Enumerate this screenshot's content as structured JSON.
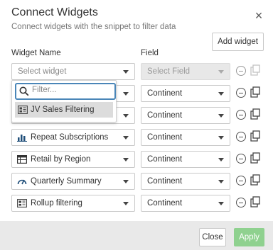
{
  "dialog": {
    "title": "Connect Widgets",
    "subtitle": "Connect widgets with the snippet to filter data",
    "close_glyph": "×",
    "add_widget_label": "Add widget",
    "col_widget": "Widget Name",
    "col_field": "Field"
  },
  "rows": [
    {
      "widget": "Select widget",
      "field": "Select Field",
      "field_disabled": true
    },
    {
      "widget": "",
      "field": "Continent",
      "icon": "dashboard-icon"
    },
    {
      "widget": "",
      "field": "Continent",
      "icon": "dashboard-icon"
    },
    {
      "widget": "Repeat Subscriptions",
      "field": "Continent",
      "icon": "bar-chart-icon"
    },
    {
      "widget": "Retail by Region",
      "field": "Continent",
      "icon": "table-icon"
    },
    {
      "widget": "Quarterly Summary",
      "field": "Continent",
      "icon": "gauge-icon"
    },
    {
      "widget": "Rollup filtering",
      "field": "Continent",
      "icon": "dashboard-icon"
    }
  ],
  "dropdown": {
    "filter_placeholder": "Filter...",
    "options": [
      {
        "label": "JV Sales Filtering",
        "icon": "dashboard-icon"
      }
    ]
  },
  "footer": {
    "close_label": "Close",
    "apply_label": "Apply"
  },
  "colors": {
    "accent": "#4a86b8",
    "apply_button": "#8fd18f",
    "footer_bg": "#e9e9e9"
  }
}
